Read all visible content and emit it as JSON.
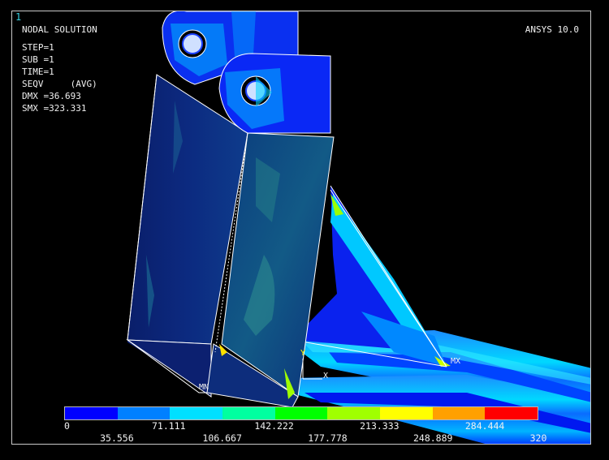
{
  "window_number": "1",
  "title": "NODAL SOLUTION",
  "software": "ANSYS 10.0",
  "info": {
    "step": "STEP=1",
    "sub": "SUB =1",
    "time": "TIME=1",
    "seqv": "SEQV     (AVG)",
    "dmx": "DMX =36.693",
    "smx": "SMX =323.331"
  },
  "markers": {
    "mn": "MN",
    "mx": "MX",
    "axis_y": "Y",
    "axis_x": "X"
  },
  "legend": {
    "colors": [
      "#0000ff",
      "#0080ff",
      "#00e0ff",
      "#00ffa0",
      "#00ff00",
      "#a0ff00",
      "#ffff00",
      "#ffa000",
      "#ff0000"
    ],
    "labels_top": [
      "0",
      "71.111",
      "142.222",
      "213.333",
      "284.444"
    ],
    "labels_bottom": [
      "35.556",
      "106.667",
      "177.778",
      "248.889",
      "320"
    ]
  }
}
